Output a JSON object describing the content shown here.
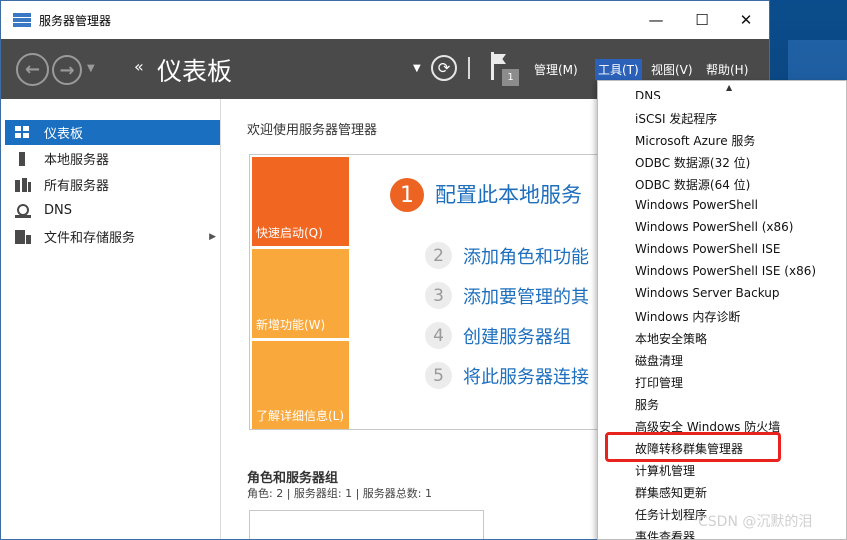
{
  "window": {
    "title": "服务器管理器",
    "controls": {
      "minimize": "—",
      "maximize": "☐",
      "close": "✕"
    }
  },
  "header": {
    "breadcrumb_arrows": "‹‹",
    "page_title": "仪表板",
    "notification_count": "1",
    "menus": [
      "管理(M)",
      "工具(T)",
      "视图(V)",
      "帮助(H)"
    ],
    "active_menu": "工具(T)"
  },
  "sidebar": {
    "items": [
      {
        "label": "仪表板",
        "icon": "dashboard-icon",
        "active": true
      },
      {
        "label": "本地服务器",
        "icon": "server-icon"
      },
      {
        "label": "所有服务器",
        "icon": "servers-icon"
      },
      {
        "label": "DNS",
        "icon": "dns-icon"
      },
      {
        "label": "文件和存储服务",
        "icon": "file-storage-icon",
        "expandable": true
      }
    ]
  },
  "main": {
    "welcome": "欢迎使用服务器管理器",
    "tiles": [
      "快速启动(Q)",
      "新增功能(W)",
      "了解详细信息(L)"
    ],
    "steps": [
      {
        "num": "1",
        "text": "配置此本地服务"
      },
      {
        "num": "2",
        "text": "添加角色和功能"
      },
      {
        "num": "3",
        "text": "添加要管理的其"
      },
      {
        "num": "4",
        "text": "创建服务器组"
      },
      {
        "num": "5",
        "text": "将此服务器连接"
      }
    ],
    "roles_title": "角色和服务器组",
    "roles_summary": "角色: 2 | 服务器组: 1 | 服务器总数: 1"
  },
  "tools_menu": {
    "items": [
      "DNS",
      "iSCSI 发起程序",
      "Microsoft Azure 服务",
      "ODBC 数据源(32 位)",
      "ODBC 数据源(64 位)",
      "Windows PowerShell",
      "Windows PowerShell (x86)",
      "Windows PowerShell ISE",
      "Windows PowerShell ISE (x86)",
      "Windows Server Backup",
      "Windows 内存诊断",
      "本地安全策略",
      "磁盘清理",
      "打印管理",
      "服务",
      "高级安全 Windows 防火墙",
      "故障转移群集管理器",
      "计算机管理",
      "群集感知更新",
      "任务计划程序",
      "事件查看器"
    ],
    "highlighted": "故障转移群集管理器"
  },
  "watermark": "CSDN @沉默的泪",
  "colors": {
    "header_bg": "#4a4a4a",
    "accent_blue": "#1a6fc1",
    "tile_orange": "#f16621",
    "tile_amber": "#f9a83c",
    "highlight_red": "#e8221d"
  }
}
